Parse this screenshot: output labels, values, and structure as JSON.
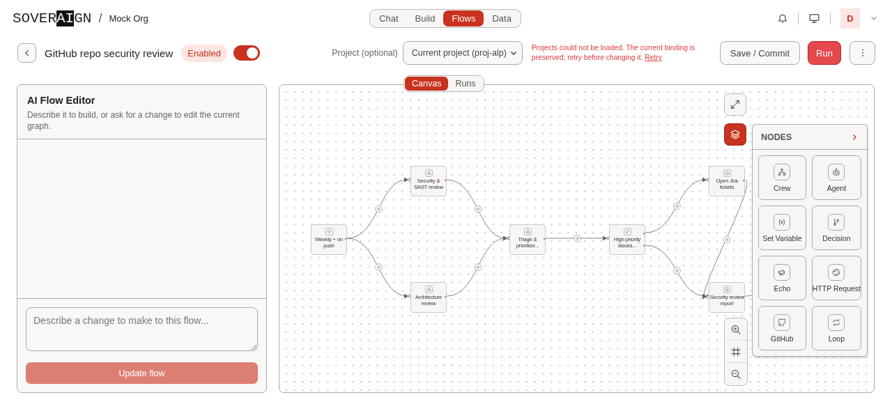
{
  "logo": [
    {
      "text": "SOVER",
      "inverted": false
    },
    {
      "text": "AI",
      "inverted": true
    },
    {
      "text": "GN",
      "inverted": false
    }
  ],
  "breadcrumb_separator": "/",
  "org": "Mock Org",
  "nav_tabs": [
    {
      "label": "Chat",
      "selected": false
    },
    {
      "label": "Build",
      "selected": false
    },
    {
      "label": "Flows",
      "selected": true
    },
    {
      "label": "Data",
      "selected": false
    }
  ],
  "user": {
    "avatar": "D"
  },
  "flow": {
    "title": "GitHub repo security review",
    "status": "Enabled",
    "enabled": true
  },
  "project": {
    "label": "Project (optional)",
    "value": "Current project (proj-alp)",
    "error": "Projects could not be loaded. The current binding is preserved; retry before changing it.",
    "retry": "Retry"
  },
  "save_button": "Save / Commit",
  "run_button": "Run",
  "editor": {
    "title": "AI Flow Editor",
    "subtitle": "Describe it to build, or ask for a change to edit the current graph.",
    "placeholder": "Describe a change to make to this flow...",
    "submit": "Update flow"
  },
  "view_tabs": [
    {
      "label": "Canvas",
      "selected": true
    },
    {
      "label": "Runs",
      "selected": false
    }
  ],
  "nodes": [
    {
      "label": "Weekly + on push",
      "kind": "trigger"
    },
    {
      "label": "Security & SAST review",
      "kind": "crew"
    },
    {
      "label": "Architecture review",
      "kind": "crew"
    },
    {
      "label": "Triage & prioritize...",
      "kind": "crew"
    },
    {
      "label": "High-priority issues...",
      "kind": "decision"
    },
    {
      "label": "Open Jira tickets",
      "kind": "http"
    },
    {
      "label": "Security review report",
      "kind": "document"
    }
  ],
  "palette": {
    "title": "NODES",
    "items": [
      {
        "label": "Crew",
        "kind": "crew"
      },
      {
        "label": "Agent",
        "kind": "agent"
      },
      {
        "label": "Set Variable",
        "kind": "variable"
      },
      {
        "label": "Decision",
        "kind": "decision"
      },
      {
        "label": "Echo",
        "kind": "echo"
      },
      {
        "label": "HTTP Request",
        "kind": "http"
      },
      {
        "label": "GitHub",
        "kind": "github"
      },
      {
        "label": "Loop",
        "kind": "loop"
      }
    ]
  }
}
